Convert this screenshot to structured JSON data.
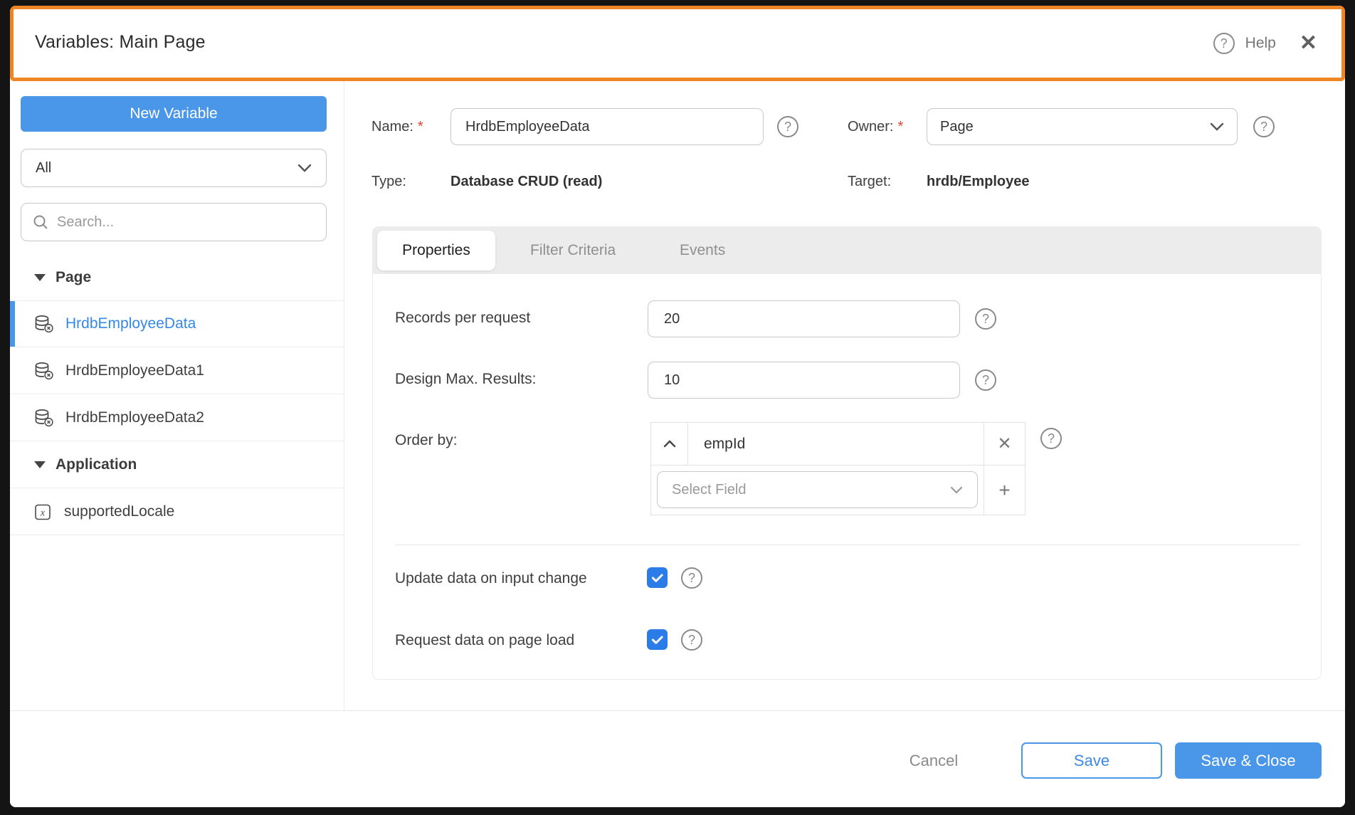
{
  "header": {
    "title": "Variables: Main Page",
    "help_label": "Help"
  },
  "sidebar": {
    "new_variable_label": "New Variable",
    "filter_value": "All",
    "search_placeholder": "Search...",
    "sections": [
      {
        "label": "Page",
        "items": [
          {
            "label": "HrdbEmployeeData",
            "icon": "database-icon",
            "selected": true
          },
          {
            "label": "HrdbEmployeeData1",
            "icon": "database-icon",
            "selected": false
          },
          {
            "label": "HrdbEmployeeData2",
            "icon": "database-icon",
            "selected": false
          }
        ]
      },
      {
        "label": "Application",
        "items": [
          {
            "label": "supportedLocale",
            "icon": "variable-icon",
            "selected": false
          }
        ]
      }
    ]
  },
  "form": {
    "name_label": "Name:",
    "required_mark": "*",
    "name_value": "HrdbEmployeeData",
    "owner_label": "Owner:",
    "owner_value": "Page",
    "type_label": "Type:",
    "type_value": "Database CRUD (read)",
    "target_label": "Target:",
    "target_value": "hrdb/Employee"
  },
  "tabs": [
    {
      "label": "Properties",
      "active": true
    },
    {
      "label": "Filter Criteria",
      "active": false
    },
    {
      "label": "Events",
      "active": false
    }
  ],
  "properties": {
    "records_label": "Records per request",
    "records_value": "20",
    "max_results_label": "Design Max. Results:",
    "max_results_value": "10",
    "order_by_label": "Order by:",
    "order_by": {
      "field": "empId",
      "direction": "ascending"
    },
    "select_field_placeholder": "Select Field",
    "update_on_change_label": "Update data on input change",
    "update_on_change_checked": true,
    "request_on_load_label": "Request data on page load",
    "request_on_load_checked": true
  },
  "footer": {
    "cancel_label": "Cancel",
    "save_label": "Save",
    "save_close_label": "Save & Close"
  },
  "icons": {
    "question_glyph": "?",
    "close_glyph": "✕",
    "remove_glyph": "✕",
    "add_glyph": "+"
  },
  "colors": {
    "accent_blue": "#4a96e8",
    "checkbox_blue": "#2b7ce9",
    "header_orange": "#ee8626",
    "selected_item_blue": "#3388e8",
    "required_red": "#e0442c"
  }
}
